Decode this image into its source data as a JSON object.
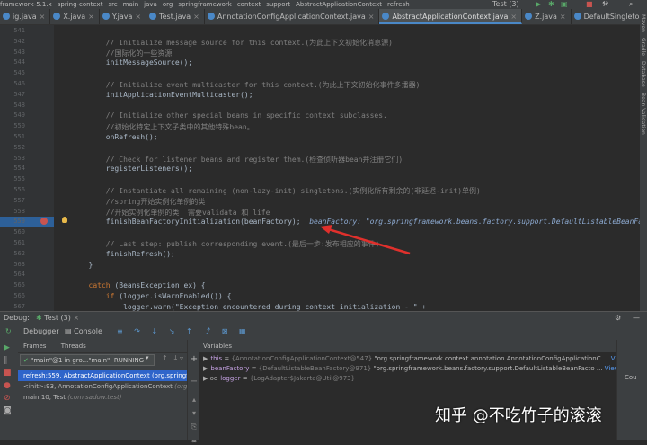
{
  "topbar": {
    "breadcrumb": [
      "framework-5.1.x",
      "spring-context",
      "src",
      "main",
      "java",
      "org",
      "springframework",
      "context",
      "support",
      "AbstractApplicationContext",
      "refresh"
    ],
    "run_config": "Test (3)"
  },
  "tabs": [
    {
      "label": "ig.java",
      "active": false
    },
    {
      "label": "X.java",
      "active": false
    },
    {
      "label": "Y.java",
      "active": false
    },
    {
      "label": "Test.java",
      "active": false
    },
    {
      "label": "AnnotationConfigApplicationContext.java",
      "active": false
    },
    {
      "label": "AbstractApplicationContext.java",
      "active": true
    },
    {
      "label": "Z.java",
      "active": false
    },
    {
      "label": "DefaultSingletonBeanRegistry.java",
      "active": false
    }
  ],
  "right_tools": [
    "Maven",
    "Gradle",
    "Database",
    "Bean Validation"
  ],
  "code_lines": [
    {
      "n": "541",
      "text": "",
      "cls": ""
    },
    {
      "n": "542",
      "text": "            // Initialize message source for this context.(为此上下文初始化消息源)",
      "cls": "cm"
    },
    {
      "n": "543",
      "text": "            //国际化的一些资源",
      "cls": "cm"
    },
    {
      "n": "544",
      "text": "            initMessageSource();",
      "cls": ""
    },
    {
      "n": "545",
      "text": "",
      "cls": ""
    },
    {
      "n": "546",
      "text": "            // Initialize event multicaster for this context.(为此上下文初始化事件多播器)",
      "cls": "cm"
    },
    {
      "n": "547",
      "text": "            initApplicationEventMulticaster();",
      "cls": ""
    },
    {
      "n": "548",
      "text": "",
      "cls": ""
    },
    {
      "n": "549",
      "text": "            // Initialize other special beans in specific context subclasses.",
      "cls": "cm"
    },
    {
      "n": "550",
      "text": "            //初始化特定上下文子类中的其他特殊bean。",
      "cls": "cm"
    },
    {
      "n": "551",
      "text": "            onRefresh();",
      "cls": ""
    },
    {
      "n": "552",
      "text": "",
      "cls": ""
    },
    {
      "n": "553",
      "text": "            // Check for listener beans and register them.(检查侦听器bean并注册它们)",
      "cls": "cm"
    },
    {
      "n": "554",
      "text": "            registerListeners();",
      "cls": ""
    },
    {
      "n": "555",
      "text": "",
      "cls": ""
    },
    {
      "n": "556",
      "text": "            // Instantiate all remaining (non-lazy-init) singletons.(实例化所有剩余的(非延迟-init)单例)",
      "cls": "cm"
    },
    {
      "n": "557",
      "text": "            //spring开始实例化单例的类",
      "cls": "cm"
    },
    {
      "n": "558",
      "text": "            //开始实例化单例的类  需要validata 和 life",
      "cls": "cm"
    },
    {
      "n": "559",
      "text": "            finishBeanFactoryInitialization(beanFactory);",
      "cls": "",
      "inline": "beanFactory: \"org.springframework.beans.factory.support.DefaultListableBeanFac"
    },
    {
      "n": "560",
      "text": "",
      "cls": ""
    },
    {
      "n": "561",
      "text": "            // Last step: publish corresponding event.(最后一步:发布相应的事件)",
      "cls": "cm"
    },
    {
      "n": "562",
      "text": "            finishRefresh();",
      "cls": ""
    },
    {
      "n": "563",
      "text": "        }",
      "cls": ""
    },
    {
      "n": "564",
      "text": "",
      "cls": ""
    },
    {
      "n": "565",
      "text": "        catch (BeansException ex) {",
      "cls": "kwline"
    },
    {
      "n": "566",
      "text": "            if (logger.isWarnEnabled()) {",
      "cls": "kwline2"
    },
    {
      "n": "567",
      "text": "                logger.warn(\"Exception encountered during context initialization - \" +",
      "cls": ""
    }
  ],
  "debug": {
    "label": "Debug:",
    "session": "Test (3)",
    "tabs": {
      "debugger": "Debugger",
      "console": "Console"
    },
    "frames_tab": "Frames",
    "threads_tab": "Threads",
    "thread_select": "\"main\"@1 in gro...\"main\": RUNNING",
    "frames": [
      {
        "text": "refresh:559, AbstractApplicationContext",
        "extra": "(org.springfr",
        "selected": true
      },
      {
        "text": "<init>:93, AnnotationConfigApplicationContext",
        "extra": "(org.s",
        "selected": false
      },
      {
        "text": "main:10, Test",
        "extra": "(com.sadow.test)",
        "selected": false
      }
    ],
    "variables_label": "Variables",
    "variables": [
      {
        "prefix": "▶",
        "name": "this",
        "type": "{AnnotationConfigApplicationContext@547}",
        "value": "\"org.springframework.context.annotation.AnnotationConfigApplicationC",
        "link": "View"
      },
      {
        "prefix": "▶",
        "name": "beanFactory",
        "type": "{DefaultListableBeanFactory@971}",
        "value": "\"org.springframework.beans.factory.support.DefaultListableBeanFacto",
        "link": "View"
      },
      {
        "prefix": "▶ oo",
        "name": "logger",
        "type": "{LogAdapter$Jakarta@Util@973}",
        "value": "",
        "link": ""
      }
    ],
    "right_label": "Cou"
  },
  "watermark": "知乎 @不吃竹子的滚滚",
  "colors": {
    "accent": "#2f65ca",
    "highlight_line": "#2d6099",
    "breakpoint": "#c75450",
    "arrow": "#e0302c"
  }
}
